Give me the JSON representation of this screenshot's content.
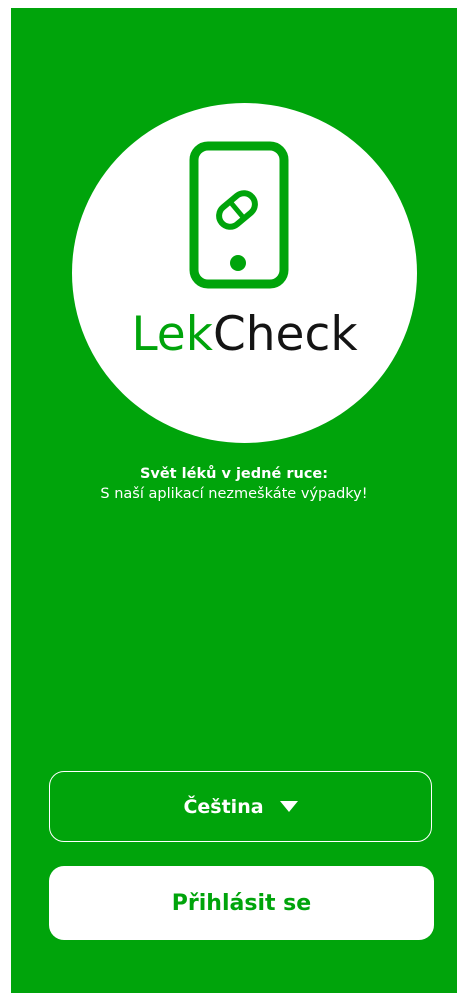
{
  "logo": {
    "brand_part1": "Lek",
    "brand_part2": "Check",
    "icon": "phone-pill-icon"
  },
  "tagline": {
    "line1": "Svět léků v jedné ruce:",
    "line2": "S naší aplikací nezmeškáte výpadky!"
  },
  "language_select": {
    "value": "Čeština",
    "icon": "caret-down-icon"
  },
  "login_button": {
    "label": "Přihlásit se"
  },
  "colors": {
    "brand_green": "#00a40b",
    "text_dark": "#141414",
    "white": "#ffffff"
  }
}
